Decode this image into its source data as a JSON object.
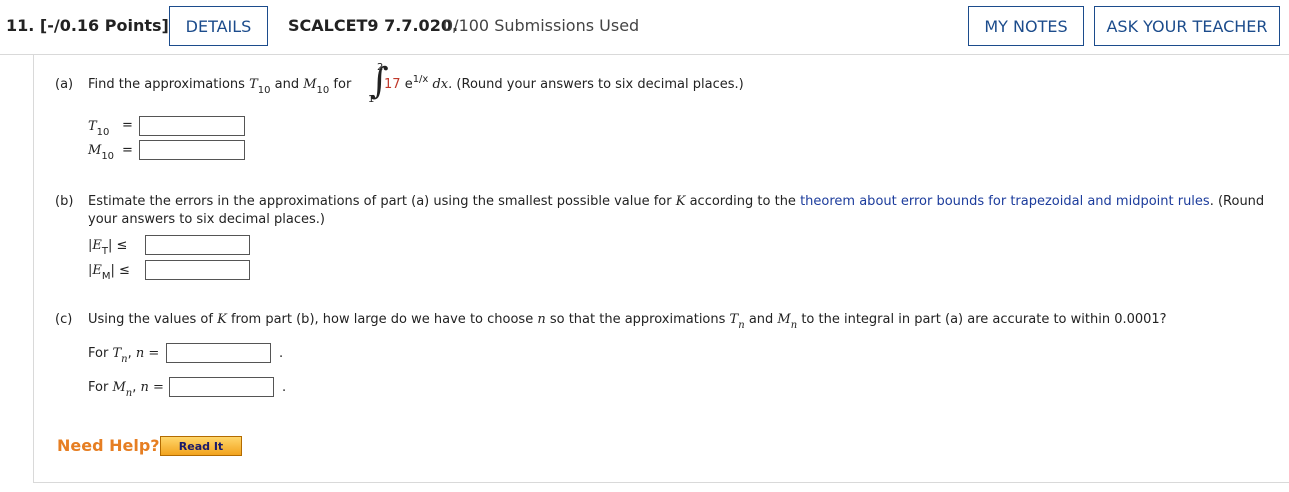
{
  "header": {
    "points": "11. [-/0.16 Points]",
    "details_label": "DETAILS",
    "problem_code": "SCALCET9 7.7.020.",
    "submissions": "0/100 Submissions Used",
    "notes_label": "MY NOTES",
    "ask_label": "ASK YOUR TEACHER"
  },
  "part_a": {
    "label": "(a)",
    "text_find": "Find the approximations",
    "T": "T",
    "M": "M",
    "n10": "10",
    "and": "and",
    "for": "for",
    "integral_lower": "1",
    "integral_upper": "2",
    "integrand_coef": "17",
    "integrand_base": "e",
    "integrand_exp": "1/x",
    "dx": "dx.",
    "round_note": "(Round your answers to six decimal places.)",
    "eq": "=",
    "T10_value": "",
    "M10_value": ""
  },
  "part_b": {
    "label": "(b)",
    "text_pre": "Estimate the errors in the approximations of part (a) using the smallest possible value for",
    "K": "K",
    "text_according": "according to the",
    "link_text": "theorem about error bounds for trapezoidal and midpoint rules",
    "text_round1": ". (Round",
    "text_round2": "your answers to six decimal places.)",
    "ET_left": "|E",
    "ET_sub": "T",
    "EM_sub": "M",
    "bar": "|",
    "leq": "≤",
    "ET_value": "",
    "EM_value": ""
  },
  "part_c": {
    "label": "(c)",
    "text_pre": "Using the values of",
    "K": "K",
    "text_mid": "from part (b), how large do we have to choose",
    "n": "n",
    "text_approx": "so that the approximations",
    "T": "T",
    "M": "M",
    "and": "and",
    "text_post": "to the integral in part (a) are accurate to within 0.0001?",
    "for_label": "For",
    "comma": ",",
    "n_eq": "n =",
    "period": ".",
    "Tn_value": "",
    "Mn_value": ""
  },
  "help": {
    "need_help": "Need Help?",
    "read_it": "Read It"
  }
}
